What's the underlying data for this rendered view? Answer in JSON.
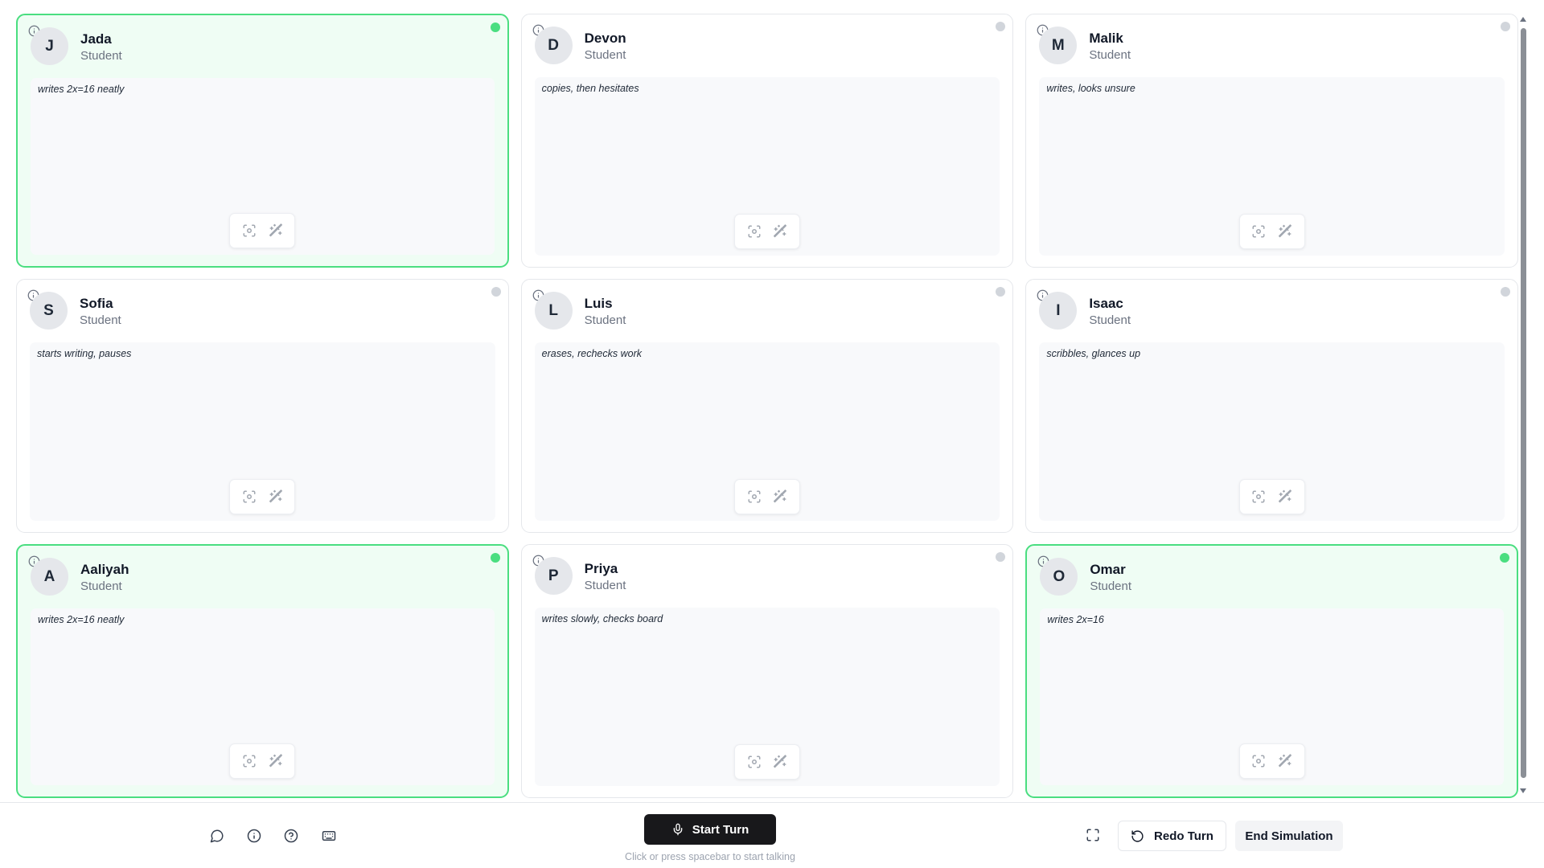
{
  "students": [
    {
      "initial": "J",
      "name": "Jada",
      "role": "Student",
      "note": "writes 2x=16 neatly",
      "active": true
    },
    {
      "initial": "D",
      "name": "Devon",
      "role": "Student",
      "note": "copies, then hesitates",
      "active": false
    },
    {
      "initial": "M",
      "name": "Malik",
      "role": "Student",
      "note": "writes, looks unsure",
      "active": false
    },
    {
      "initial": "S",
      "name": "Sofia",
      "role": "Student",
      "note": "starts writing, pauses",
      "active": false
    },
    {
      "initial": "L",
      "name": "Luis",
      "role": "Student",
      "note": "erases, rechecks work",
      "active": false
    },
    {
      "initial": "I",
      "name": "Isaac",
      "role": "Student",
      "note": "scribbles, glances up",
      "active": false
    },
    {
      "initial": "A",
      "name": "Aaliyah",
      "role": "Student",
      "note": "writes 2x=16 neatly",
      "active": true
    },
    {
      "initial": "P",
      "name": "Priya",
      "role": "Student",
      "note": "writes slowly, checks board",
      "active": false
    },
    {
      "initial": "O",
      "name": "Omar",
      "role": "Student",
      "note": "writes 2x=16",
      "active": true
    }
  ],
  "card_icons": {
    "info": "info-icon",
    "capture": "focus-capture-icon",
    "magic": "magic-wand-icon"
  },
  "footer": {
    "icons": [
      "chat-icon",
      "info-icon",
      "help-icon",
      "keyboard-icon"
    ],
    "start_turn_label": "Start Turn",
    "hint": "Click or press spacebar to start talking",
    "expand_icon": "fullscreen-icon",
    "redo_label": "Redo Turn",
    "end_label": "End Simulation"
  },
  "colors": {
    "active_border": "#4ade80",
    "active_bg": "#effdf4",
    "idle_dot": "#d1d5db",
    "primary_button": "#18181b"
  }
}
